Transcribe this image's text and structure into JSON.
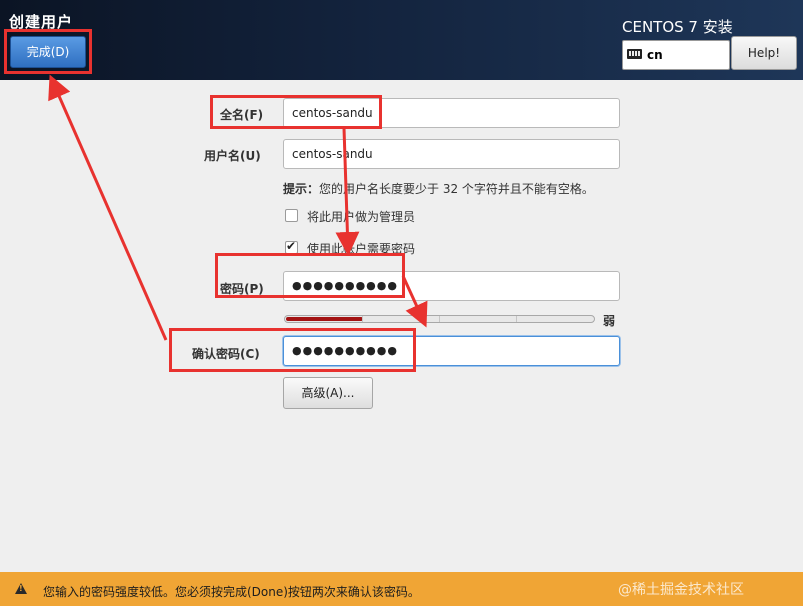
{
  "header": {
    "title": "创建用户",
    "done_label": "完成(D)",
    "product": "CENTOS 7 安装",
    "keyboard_layout": "cn",
    "help_label": "Help!"
  },
  "form": {
    "fullname_label": "全名(F)",
    "fullname_value": "centos-sandu",
    "username_label": "用户名(U)",
    "username_value": "centos-sandu",
    "hint_prefix": "提示：",
    "hint_text": "您的用户名长度要少于 32 个字符并且不能有空格。",
    "admin_checkbox_label": "将此用户做为管理员",
    "admin_checked": false,
    "require_password_label": "使用此帐户需要密码",
    "require_password_checked": true,
    "password_label": "密码(P)",
    "password_value": "●●●●●●●●●●",
    "strength_fraction": 0.25,
    "strength_label": "弱",
    "confirm_label": "确认密码(C)",
    "confirm_value": "●●●●●●●●●●",
    "advanced_label": "高级(A)..."
  },
  "warning": {
    "text": "您输入的密码强度较低。您必须按完成(Done)按钮两次来确认该密码。",
    "watermark": "@稀土掘金技术社区"
  },
  "colors": {
    "header_bg": "#13233d",
    "done_button": "#3b7fd0",
    "warning_bar": "#f0a535",
    "strength_fill": "#a31313",
    "annotation": "#e8322f"
  }
}
